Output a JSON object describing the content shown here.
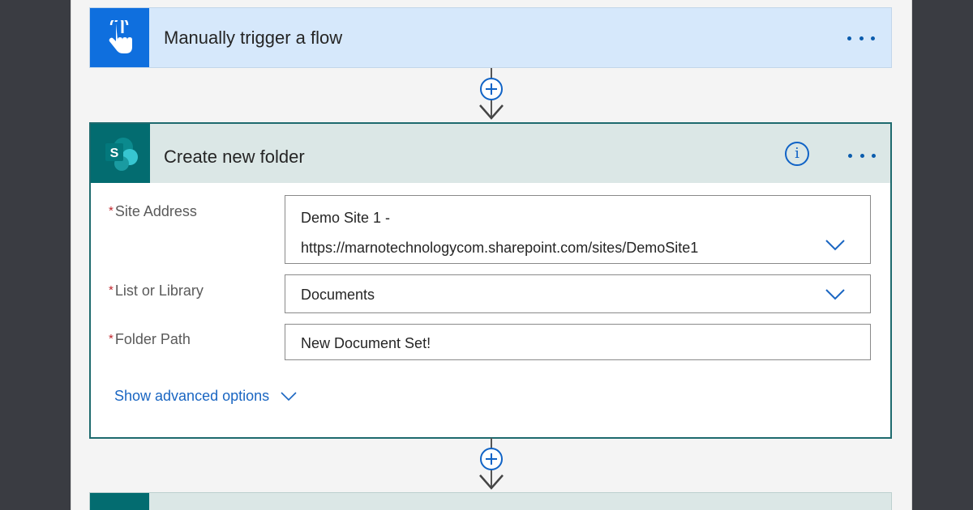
{
  "trigger": {
    "title": "Manually trigger a flow",
    "icon": "touch-hand-icon",
    "accent": "#0f6fde"
  },
  "action": {
    "icon": "sharepoint-icon",
    "icon_letter": "S",
    "title": "Create new folder",
    "info_glyph": "i",
    "fields": {
      "site_address": {
        "label": "Site Address",
        "required_mark": "*",
        "value_line1": "Demo Site 1 -",
        "value_line2": "https://marnotechnologycom.sharepoint.com/sites/DemoSite1"
      },
      "list_or_library": {
        "label": "List or Library",
        "required_mark": "*",
        "value": "Documents"
      },
      "folder_path": {
        "label": "Folder Path",
        "required_mark": "*",
        "value": "New Document Set!"
      }
    },
    "advanced_link": "Show advanced options",
    "accent": "#036c70"
  },
  "colors": {
    "link": "#1a66c2",
    "required": "#c0262d",
    "border_selected": "#1e6a6e"
  }
}
